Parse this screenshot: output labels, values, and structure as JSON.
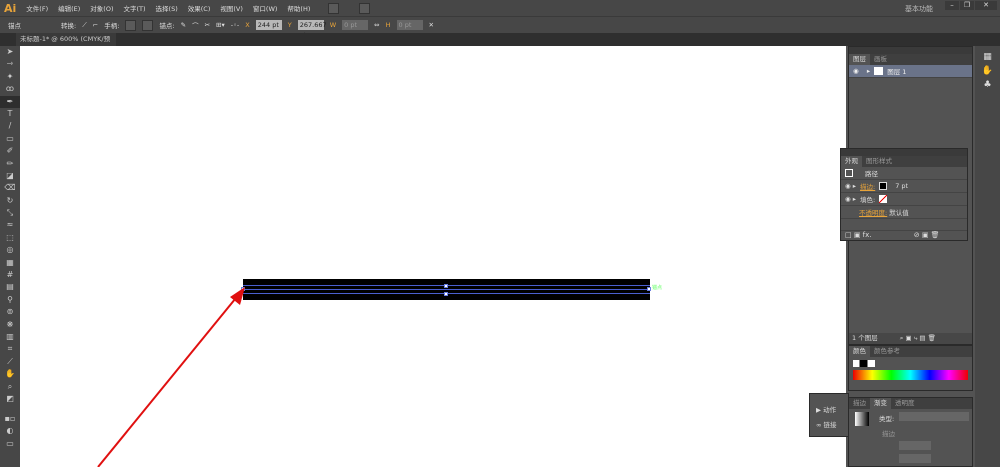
{
  "app": {
    "logo": "Ai",
    "workspace": "基本功能"
  },
  "menu": [
    "文件(F)",
    "编辑(E)",
    "对象(O)",
    "文字(T)",
    "选择(S)",
    "效果(C)",
    "视图(V)",
    "窗口(W)",
    "帮助(H)"
  ],
  "control": {
    "mode": "锚点",
    "convert": "转换:",
    "handles": "手柄:",
    "anchors": "锚点:",
    "x": "244 pt",
    "y": "267.667 pt",
    "w": "0 pt",
    "h": "0 pt"
  },
  "document": {
    "tab": "未标题-1* @ 600% (CMYK/预览)",
    "anchor_label": "锚点"
  },
  "layers": {
    "tabs": [
      "图层",
      "画板"
    ],
    "layer": "图层 1",
    "count": "1 个图层"
  },
  "appearance": {
    "tabs": [
      "外观",
      "图形样式"
    ],
    "title": "路径",
    "stroke": "描边:",
    "stroke_value": "7 pt",
    "fill": "填色:",
    "opacity": "不透明度:",
    "opacity_value": "默认值"
  },
  "color": {
    "tabs": [
      "颜色",
      "颜色参考"
    ]
  },
  "actions": {
    "items": [
      "动作",
      "链接"
    ]
  },
  "gradient": {
    "tabs": [
      "描边",
      "渐变",
      "透明度"
    ],
    "type": "类型:",
    "stroke": "描边"
  },
  "colors": {
    "accent": "#e8a43a",
    "path": "#4a5fd0",
    "arrow": "#e01010"
  }
}
